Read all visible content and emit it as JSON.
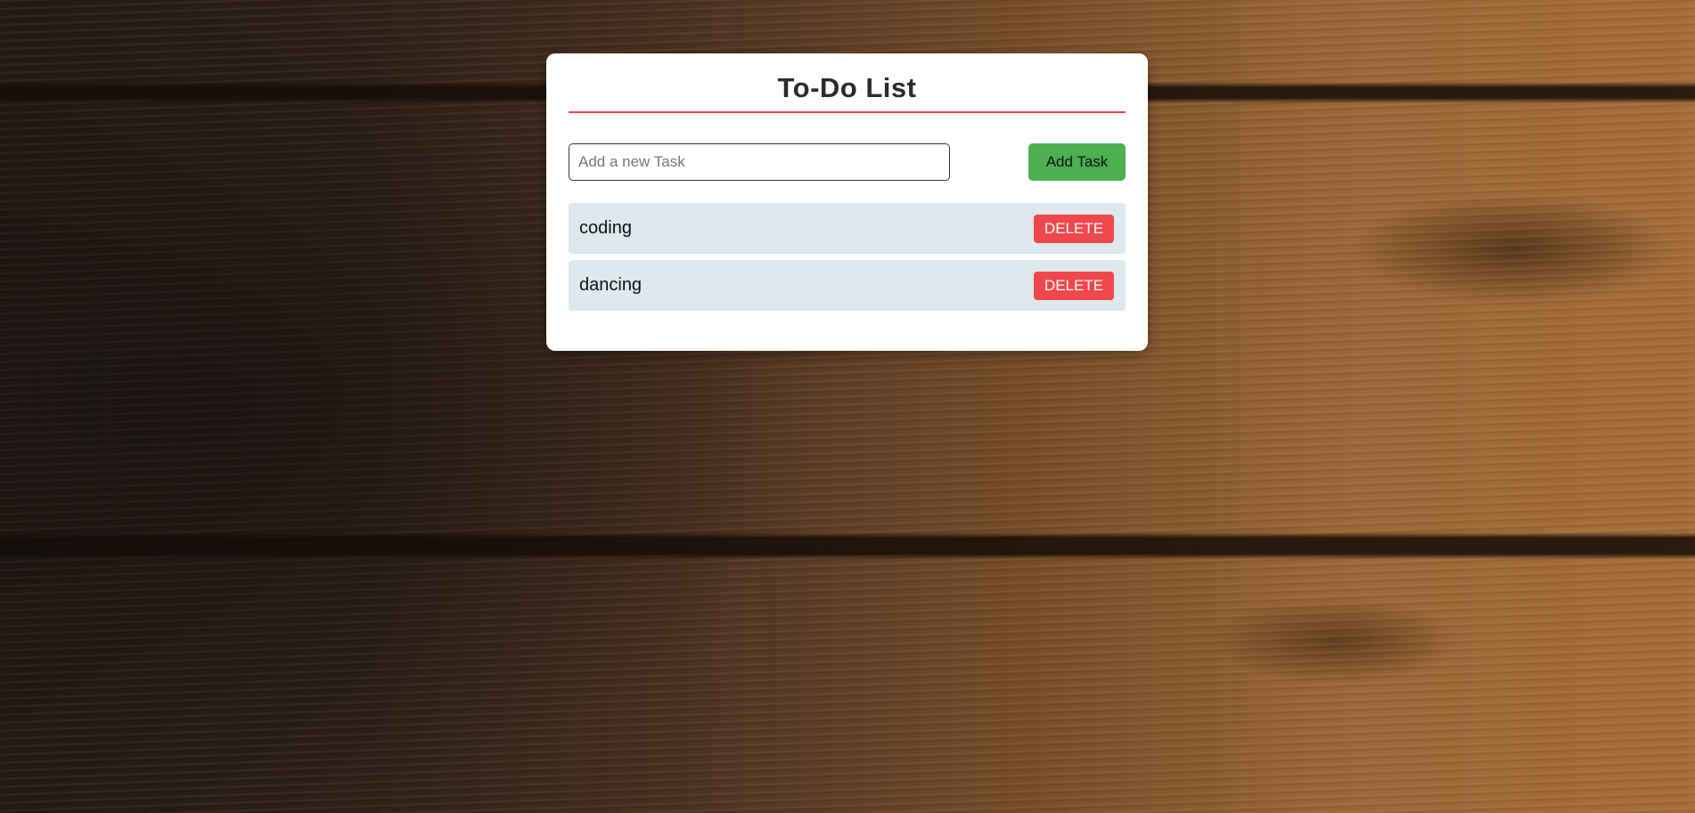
{
  "app": {
    "title": "To-Do List"
  },
  "form": {
    "input_value": "",
    "input_placeholder": "Add a new Task",
    "add_label": "Add Task"
  },
  "tasks": [
    {
      "text": "coding",
      "delete_label": "DELETE"
    },
    {
      "text": "dancing",
      "delete_label": "DELETE"
    }
  ],
  "colors": {
    "title_underline": "#ef4444",
    "add_button": "#4caf50",
    "delete_button": "#f0474c",
    "task_background": "#dde9ec",
    "card_background": "#ffffff"
  }
}
